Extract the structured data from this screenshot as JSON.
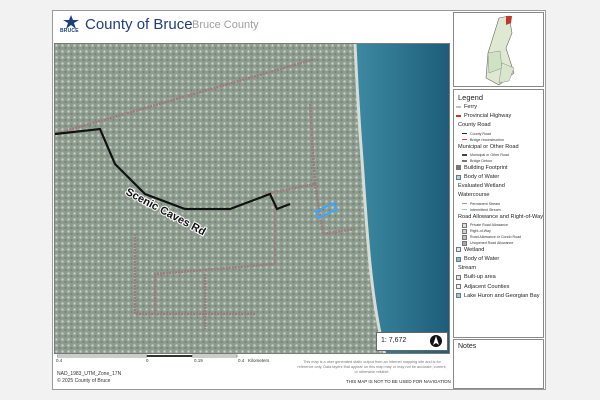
{
  "header": {
    "org_name": "County of Bruce",
    "map_name": "Bruce County",
    "logo_text": "BRUCE",
    "brand_color": "#1d3f7a"
  },
  "map": {
    "road_label": "Scenic Caves Rd",
    "scale_ratio": "1: 7,672",
    "north_arrow_icon": "north-arrow-icon",
    "colors": {
      "water": "#2b6e8c",
      "land": "#8a9a8a",
      "parcel": "#9b7b7b",
      "highlight": "#39a7ff",
      "road": "#111111"
    }
  },
  "scalebar": {
    "ticks": [
      "0.4",
      "0",
      "0.19",
      "0.4"
    ],
    "unit": "Kilometers"
  },
  "footer": {
    "crs": "NAD_1983_UTM_Zone_17N",
    "copyright": "© 2025 County of Bruce",
    "disclaimer": "This map is a user generated static output from an Internet mapping site and is for reference only. Data layers that appear on this map may or may not be accurate, current, or otherwise reliable.",
    "nav_warning": "THIS MAP IS NOT TO BE USED FOR NAVIGATION"
  },
  "legend": {
    "title": "Legend",
    "items": [
      {
        "label": "Ferry",
        "sub": false,
        "color": "#c2c2c2",
        "kind": "line"
      },
      {
        "label": "Provincial Highway",
        "sub": false,
        "color": "#c0392b",
        "kind": "line"
      },
      {
        "label": "County Road",
        "sub": false,
        "color": "#ffffff",
        "kind": "none"
      },
      {
        "label": "County Road",
        "sub": true,
        "color": "#222222",
        "kind": "line"
      },
      {
        "label": "Bridge reconstruction",
        "sub": true,
        "color": "#d04040",
        "kind": "line"
      },
      {
        "label": "Municipal or Other Road",
        "sub": false,
        "color": "#ffffff",
        "kind": "none"
      },
      {
        "label": "Municipal or Other Road",
        "sub": true,
        "color": "#444444",
        "kind": "line"
      },
      {
        "label": "Bridge Detour",
        "sub": true,
        "color": "#777777",
        "kind": "line"
      },
      {
        "label": "Building Footprint",
        "sub": false,
        "color": "#777777",
        "kind": "box"
      },
      {
        "label": "Body of Water",
        "sub": false,
        "color": "#a8d7e6",
        "kind": "box"
      },
      {
        "label": "Evaluated Wetland",
        "sub": false,
        "color": "#ffffff",
        "kind": "none"
      },
      {
        "label": "Watercourse",
        "sub": false,
        "color": "#ffffff",
        "kind": "none"
      },
      {
        "label": "Permanent Stream",
        "sub": true,
        "color": "#6fa8c8",
        "kind": "line"
      },
      {
        "label": "Intermittent Stream",
        "sub": true,
        "color": "#9fc4d8",
        "kind": "line"
      },
      {
        "label": "Road Allowance and Right-of-Way",
        "sub": false,
        "color": "#ffffff",
        "kind": "none"
      },
      {
        "label": "Private Road Allowance",
        "sub": true,
        "color": "#dddddd",
        "kind": "box"
      },
      {
        "label": "Right-of-Way",
        "sub": true,
        "color": "#cfcfcf",
        "kind": "box"
      },
      {
        "label": "Road Allowance or Condo Road",
        "sub": true,
        "color": "#bdbdbd",
        "kind": "box"
      },
      {
        "label": "Unopened Road Allowance",
        "sub": true,
        "color": "#a9a9a9",
        "kind": "box"
      },
      {
        "label": "Wetland",
        "sub": false,
        "color": "#d6eaf2",
        "kind": "box"
      },
      {
        "label": "Body of Water",
        "sub": false,
        "color": "#7fc0d9",
        "kind": "box"
      },
      {
        "label": "Stream",
        "sub": false,
        "color": "#ffffff",
        "kind": "none"
      },
      {
        "label": "Built-up area",
        "sub": false,
        "color": "#f1e4c8",
        "kind": "box"
      },
      {
        "label": "Adjacent Counties",
        "sub": false,
        "color": "#efefef",
        "kind": "box"
      },
      {
        "label": "Lake Huron and Georgian Bay",
        "sub": false,
        "color": "#93cfe0",
        "kind": "box"
      }
    ]
  },
  "notes": {
    "title": "Notes"
  }
}
